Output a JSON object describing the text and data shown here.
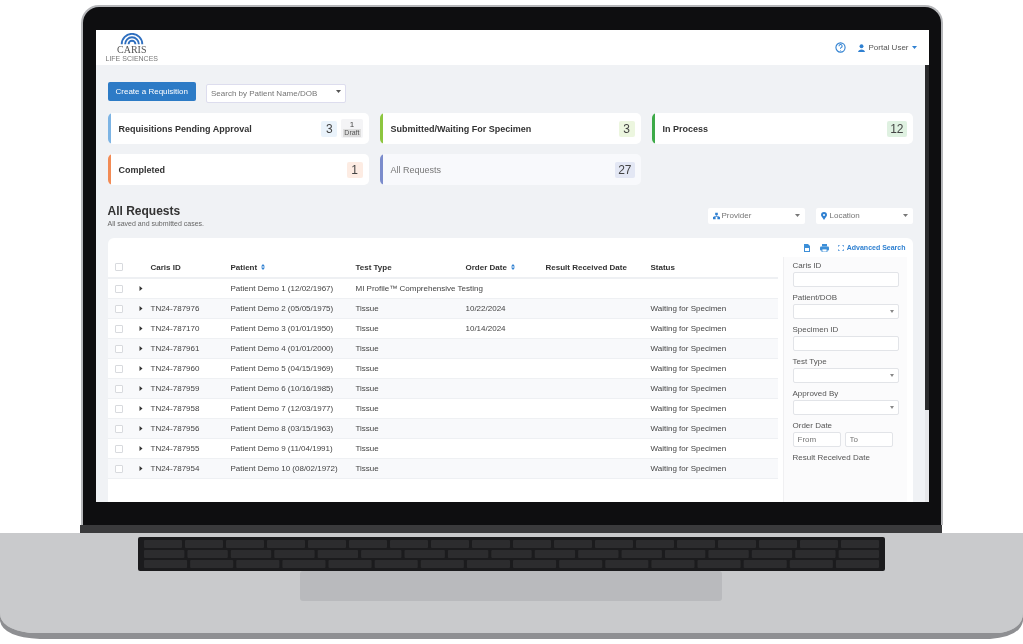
{
  "header": {
    "logo_text": "CARIS",
    "logo_subtext": "LIFE SCIENCES",
    "user": "Portal User"
  },
  "toolbar": {
    "create_button": "Create a Requisition",
    "search_placeholder": "Search by Patient Name/DOB"
  },
  "cards": [
    {
      "title": "Requisitions Pending Approval",
      "count": "3",
      "color": "#7db4e4",
      "selected": false,
      "draft": {
        "count": "1",
        "label": "Draft"
      }
    },
    {
      "title": "Submitted/Waiting For Specimen",
      "count": "3",
      "color": "#8dc63f",
      "selected": false
    },
    {
      "title": "In Process",
      "count": "12",
      "color": "#3daa48",
      "selected": false
    },
    {
      "title": "Completed",
      "count": "1",
      "color": "#f28b55",
      "selected": false
    },
    {
      "title": "All Requests",
      "count": "27",
      "color": "#7b8ccc",
      "selected": true
    }
  ],
  "section": {
    "title": "All Requests",
    "subtitle": "All saved and submitted cases.",
    "filters": [
      {
        "kind": "provider",
        "placeholder": "Provider"
      },
      {
        "kind": "location",
        "placeholder": "Location"
      }
    ]
  },
  "table": {
    "advanced_search": "Advanced Search",
    "select_all_checked": false,
    "columns": [
      {
        "label": "Caris ID",
        "sortable": false
      },
      {
        "label": "Patient",
        "sortable": true
      },
      {
        "label": "Test Type",
        "sortable": false
      },
      {
        "label": "Order Date",
        "sortable": true
      },
      {
        "label": "Result Received Date",
        "sortable": false
      },
      {
        "label": "Status",
        "sortable": false
      }
    ],
    "rows": [
      {
        "checked": false,
        "expanded": false,
        "patient": "Patient Demo 1 (12/02/1967)",
        "test_type": "MI Profile™ Comprehensive Testing"
      },
      {
        "checked": false,
        "expanded": false,
        "caris_id": "TN24-787976",
        "patient": "Patient Demo 2 (05/05/1975)",
        "test_type": "Tissue",
        "order_date": "10/22/2024",
        "status": "Waiting for Specimen"
      },
      {
        "checked": false,
        "expanded": false,
        "caris_id": "TN24-787170",
        "patient": "Patient Demo 3 (01/01/1950)",
        "test_type": "Tissue",
        "order_date": "10/14/2024",
        "status": "Waiting for Specimen"
      },
      {
        "checked": false,
        "expanded": false,
        "caris_id": "TN24-787961",
        "patient": "Patient Demo 4 (01/01/2000)",
        "test_type": "Tissue",
        "status": "Waiting for Specimen"
      },
      {
        "checked": false,
        "expanded": false,
        "caris_id": "TN24-787960",
        "patient": "Patient Demo 5 (04/15/1969)",
        "test_type": "Tissue",
        "status": "Waiting for Specimen"
      },
      {
        "checked": false,
        "expanded": false,
        "caris_id": "TN24-787959",
        "patient": "Patient Demo 6 (10/16/1985)",
        "test_type": "Tissue",
        "status": "Waiting for Specimen"
      },
      {
        "checked": false,
        "expanded": false,
        "caris_id": "TN24-787958",
        "patient": "Patient Demo 7 (12/03/1977)",
        "test_type": "Tissue",
        "status": "Waiting for Specimen"
      },
      {
        "checked": false,
        "expanded": false,
        "caris_id": "TN24-787956",
        "patient": "Patient Demo 8 (03/15/1963)",
        "test_type": "Tissue",
        "status": "Waiting for Specimen"
      },
      {
        "checked": false,
        "expanded": false,
        "caris_id": "TN24-787955",
        "patient": "Patient Demo 9 (11/04/1991)",
        "test_type": "Tissue",
        "status": "Waiting for Specimen"
      },
      {
        "checked": false,
        "expanded": false,
        "caris_id": "TN24-787954",
        "patient": "Patient Demo 10 (08/02/1972)",
        "test_type": "Tissue",
        "status": "Waiting for Specimen"
      }
    ]
  },
  "search_panel": {
    "fields": [
      {
        "kind": "input",
        "label": "Caris ID"
      },
      {
        "kind": "select",
        "label": "Patient/DOB"
      },
      {
        "kind": "input",
        "label": "Specimen ID"
      },
      {
        "kind": "select",
        "label": "Test Type"
      },
      {
        "kind": "select",
        "label": "Approved By"
      },
      {
        "kind": "range",
        "label": "Order Date",
        "from_placeholder": "From",
        "to_placeholder": "To"
      },
      {
        "kind": "label",
        "label": "Result Received Date"
      }
    ]
  }
}
